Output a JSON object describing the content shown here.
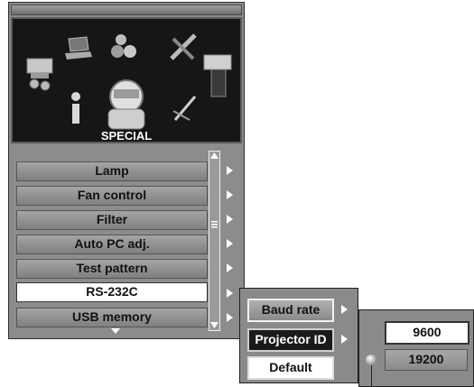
{
  "main_menu": {
    "category_label": "SPECIAL",
    "items": [
      {
        "label": "Lamp"
      },
      {
        "label": "Fan control"
      },
      {
        "label": "Filter"
      },
      {
        "label": "Auto PC adj."
      },
      {
        "label": "Test pattern"
      },
      {
        "label": "RS-232C",
        "selected": true
      },
      {
        "label": "USB memory"
      }
    ]
  },
  "submenu": {
    "items": [
      {
        "label": "Baud rate",
        "selected": true
      },
      {
        "label": "Projector ID"
      },
      {
        "label": "Default"
      }
    ]
  },
  "baud_options": {
    "items": [
      {
        "label": "9600",
        "selected": true
      },
      {
        "label": "19200"
      }
    ]
  },
  "colors": {
    "panel": "#8c8c8c",
    "icon_panel": "#161616",
    "selected": "#ffffff"
  },
  "icons": [
    "laptop-icon",
    "balls-icon",
    "tools-icon",
    "screen-icon",
    "source-icon",
    "info-icon",
    "person-icon",
    "wrench-icon"
  ]
}
